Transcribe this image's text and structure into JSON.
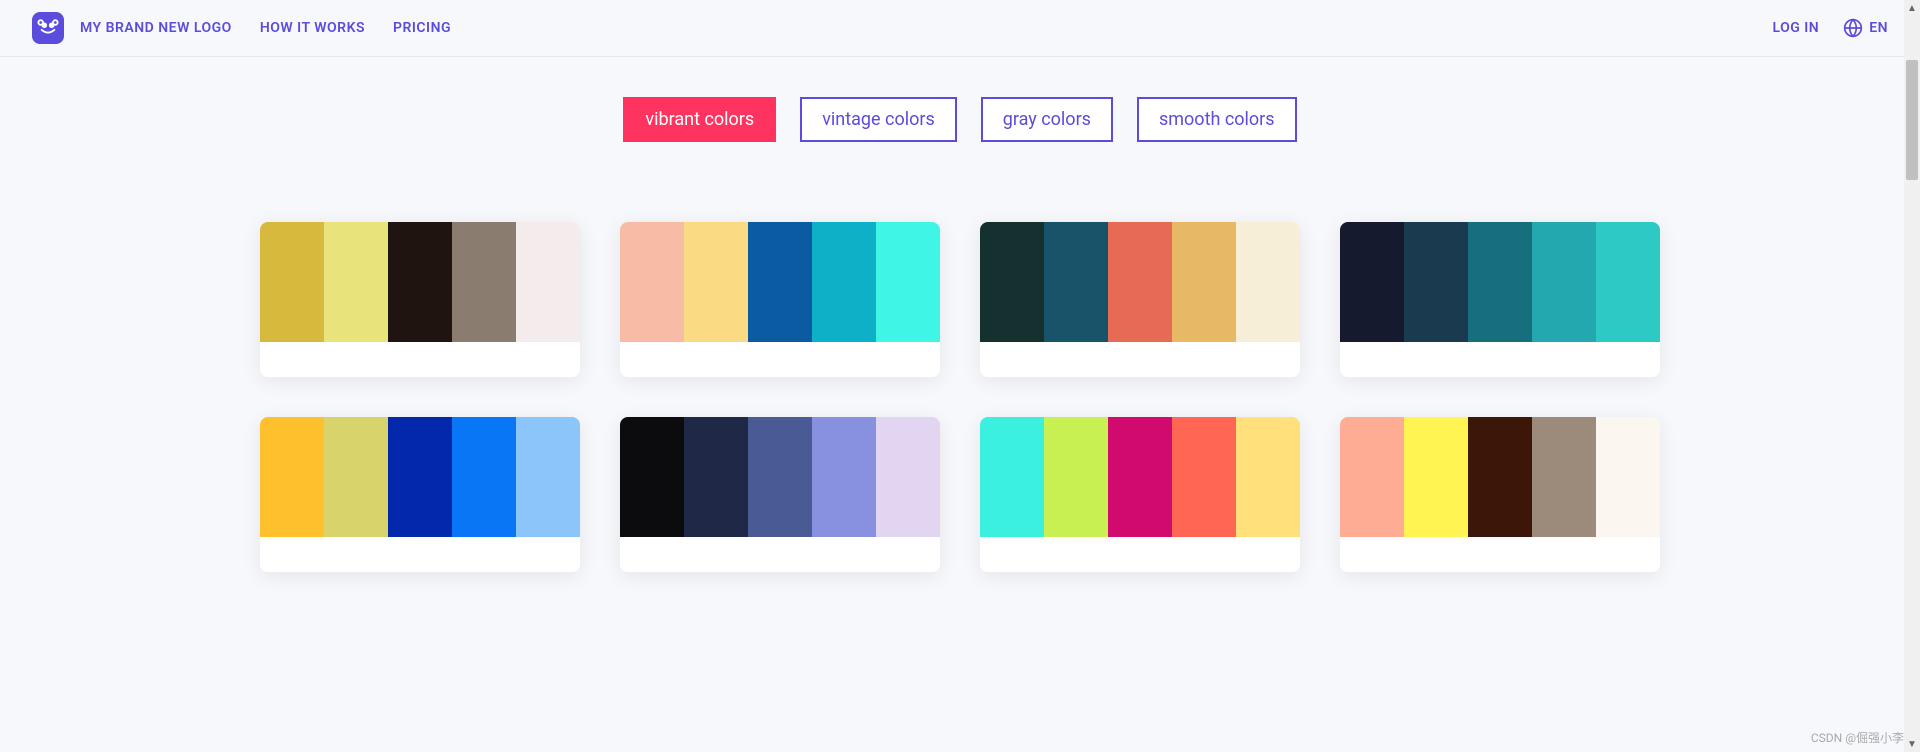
{
  "header": {
    "brand": "MY BRAND NEW LOGO",
    "nav": {
      "how_it_works": "HOW IT WORKS",
      "pricing": "PRICING"
    },
    "login": "LOG IN",
    "lang": "EN"
  },
  "filters": [
    {
      "label": "vibrant colors",
      "active": true
    },
    {
      "label": "vintage colors",
      "active": false
    },
    {
      "label": "gray colors",
      "active": false
    },
    {
      "label": "smooth colors",
      "active": false
    }
  ],
  "palettes": [
    {
      "colors": [
        "#d6b93d",
        "#e8e37a",
        "#1f1410",
        "#8a7d70",
        "#f4ecec"
      ]
    },
    {
      "colors": [
        "#f8bba5",
        "#fadb84",
        "#0b5ba3",
        "#0db0c7",
        "#3ff5e6"
      ]
    },
    {
      "colors": [
        "#143130",
        "#175469",
        "#e66a54",
        "#e8b964",
        "#f6eed7"
      ]
    },
    {
      "colors": [
        "#151a2e",
        "#1a3a50",
        "#176e7d",
        "#23a8b0",
        "#2cc9c5"
      ]
    },
    {
      "colors": [
        "#ffc02e",
        "#d8d36b",
        "#0328ab",
        "#0976f5",
        "#8cc5f9"
      ]
    },
    {
      "colors": [
        "#0c0c0e",
        "#1f2847",
        "#4a5a94",
        "#8791e0",
        "#e2d5f2"
      ]
    },
    {
      "colors": [
        "#3cf0e0",
        "#c8f053",
        "#d00a6e",
        "#ff6654",
        "#ffe07a"
      ]
    },
    {
      "colors": [
        "#ffac95",
        "#fff452",
        "#3c1608",
        "#9c8a7a",
        "#fbf7f0"
      ]
    }
  ],
  "watermark": "CSDN @倔强小李"
}
